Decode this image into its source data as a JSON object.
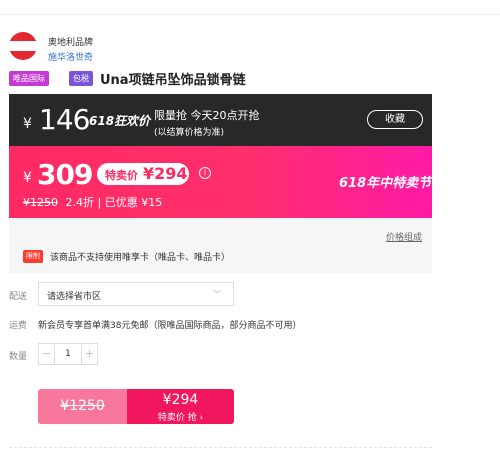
{
  "brand": {
    "name": "奥地利品牌",
    "shop": "施华洛世奇"
  },
  "tags": {
    "intl": "唯品国际",
    "tax_included": "包税"
  },
  "product": {
    "title": "Una项链吊坠饰品锁骨链"
  },
  "presale": {
    "currency": "¥",
    "price": "146",
    "flag": "618狂欢价",
    "message": "限量抢 今天20点开抢",
    "note": "(以结算价格为准)",
    "favorite_label": "收藏"
  },
  "sale": {
    "currency": "¥",
    "price": "309",
    "special_label": "特卖价",
    "special_price": "¥294",
    "info_icon": "ⓘ",
    "original_price": "¥1250",
    "discount": "2.4折",
    "saving": "| 已优惠 ¥15",
    "event_name": "618年中特卖节"
  },
  "notice": {
    "price_breakdown_link": "价格组成",
    "badge": "限制",
    "text": "该商品不支持使用唯享卡（唯品卡、唯品卡）"
  },
  "delivery": {
    "label": "配送",
    "placeholder": "请选择省市区",
    "chevron": "﹀"
  },
  "shipping": {
    "label": "运费",
    "text": "新会员专享首单满38元免邮（限唯品国际商品，部分商品不可用）"
  },
  "quantity": {
    "label": "数量",
    "value": "1",
    "minus": "−",
    "plus": "+"
  },
  "buy": {
    "original_price": "¥1250",
    "price": "¥294",
    "label": "特卖价 抢 ›"
  },
  "colors": {
    "sale_pink": "#ff2a62",
    "dark_bar": "#282828",
    "buy_button": "#f0175f",
    "buy_light": "#f7789c"
  },
  "icons": {
    "brand_logo": "austria-flag-icon",
    "info": "info-icon",
    "dropdown": "chevron-down-icon"
  }
}
